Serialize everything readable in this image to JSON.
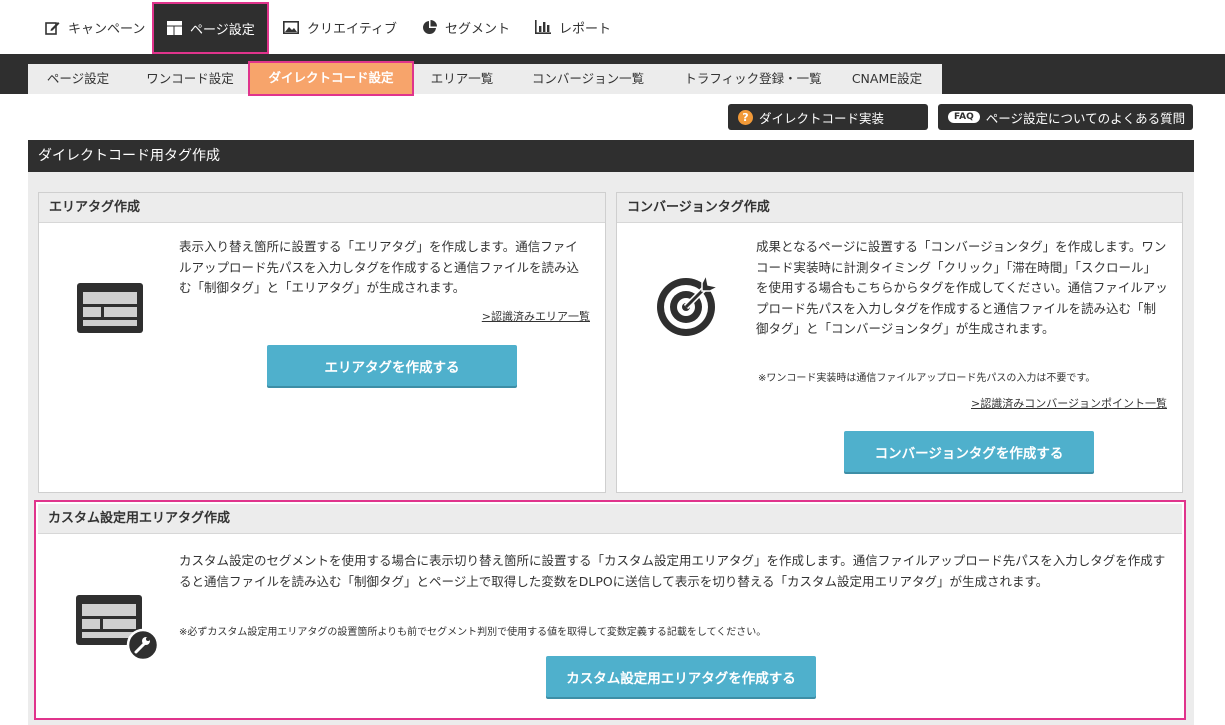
{
  "topnav": {
    "items": [
      {
        "label": "キャンペーン",
        "icon": "edit-icon"
      },
      {
        "label": "ページ設定",
        "icon": "layout-icon",
        "active": true
      },
      {
        "label": "クリエイティブ",
        "icon": "image-icon"
      },
      {
        "label": "セグメント",
        "icon": "pie-chart-icon"
      },
      {
        "label": "レポート",
        "icon": "bar-chart-icon"
      }
    ]
  },
  "subnav": {
    "tabs": [
      {
        "label": "ページ設定"
      },
      {
        "label": "ワンコード設定"
      },
      {
        "label": "ダイレクトコード設定",
        "active": true
      },
      {
        "label": "エリア一覧"
      },
      {
        "label": "コンバージョン一覧"
      },
      {
        "label": "トラフィック登録・一覧"
      },
      {
        "label": "CNAME設定"
      }
    ]
  },
  "actions": {
    "direct_code_label": "ダイレクトコード実装",
    "faq_badge": "FAQ",
    "faq_label": "ページ設定についてのよくある質問"
  },
  "section": {
    "title": "ダイレクトコード用タグ作成"
  },
  "area_panel": {
    "title": "エリアタグ作成",
    "description": "表示入り替え箇所に設置する「エリアタグ」を作成します。通信ファイルアップロード先パスを入力しタグを作成すると通信ファイルを読み込む「制御タグ」と「エリアタグ」が生成されます。",
    "link": ">認識済みエリア一覧",
    "button": "エリアタグを作成する"
  },
  "conversion_panel": {
    "title": "コンバージョンタグ作成",
    "description": "成果となるページに設置する「コンバージョンタグ」を作成します。ワンコード実装時に計測タイミング「クリック」「滞在時間」「スクロール」を使用する場合もこちらからタグを作成してください。通信ファイルアップロード先パスを入力しタグを作成すると通信ファイルを読み込む「制御タグ」と「コンバージョンタグ」が生成されます。",
    "note": "※ワンコード実装時は通信ファイルアップロード先パスの入力は不要です。",
    "link": ">認識済みコンバージョンポイント一覧",
    "button": "コンバージョンタグを作成する"
  },
  "custom_panel": {
    "title": "カスタム設定用エリアタグ作成",
    "description": "カスタム設定のセグメントを使用する場合に表示切り替え箇所に設置する「カスタム設定用エリアタグ」を作成します。通信ファイルアップロード先パスを入力しタグを作成すると通信ファイルを読み込む「制御タグ」とページ上で取得した変数をDLPOに送信して表示を切り替える「カスタム設定用エリアタグ」が生成されます。",
    "note": "※必ずカスタム設定用エリアタグの設置箇所よりも前でセグメント判別で使用する値を取得して変数定義する記載をしてください。",
    "button": "カスタム設定用エリアタグを作成する"
  }
}
